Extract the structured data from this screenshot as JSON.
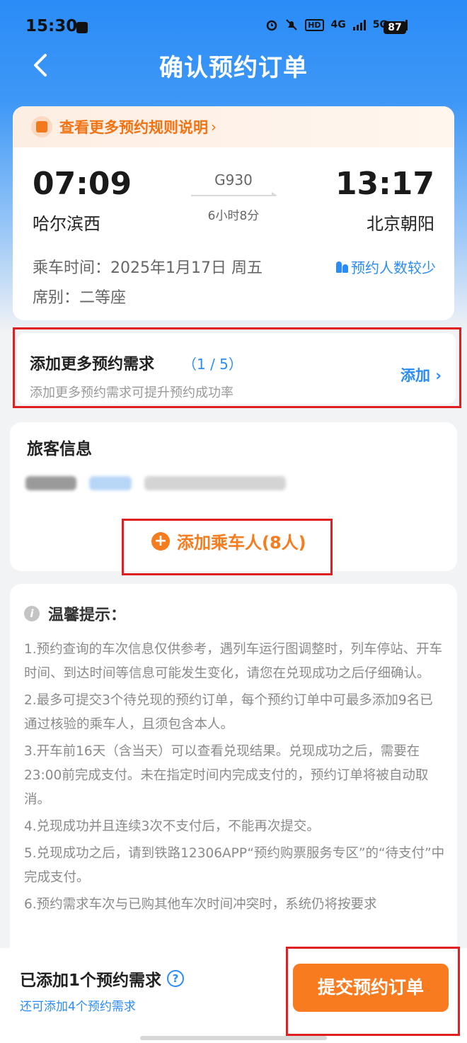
{
  "status": {
    "time": "15:30",
    "battery": "87",
    "net1": "4G",
    "net2": "5G"
  },
  "nav": {
    "title": "确认预约订单"
  },
  "rules": {
    "text": "查看更多预约规则说明",
    "chev": "›"
  },
  "trip": {
    "dep_time": "07:09",
    "arr_time": "13:17",
    "dep_station": "哈尔滨西",
    "arr_station": "北京朝阳",
    "train_no": "G930",
    "duration": "6小时8分",
    "ride_date": "乘车时间：2025年1月17日 周五",
    "seat": "席别：二等座",
    "few_people": "预约人数较少"
  },
  "requirement": {
    "title": "添加更多预约需求",
    "count": "（1 / 5）",
    "sub": "添加更多预约需求可提升预约成功率",
    "add": "添加 ›"
  },
  "passenger": {
    "title": "旅客信息",
    "add_label": "添加乘车人(8人)"
  },
  "tips": {
    "title": "温馨提示：",
    "items": [
      "1.预约查询的车次信息仅供参考，遇列车运行图调整时，列车停站、开车时间、到达时间等信息可能发生变化，请您在兑现成功之后仔细确认。",
      "2.最多可提交3个待兑现的预约订单，每个预约订单中可最多添加9名已通过核验的乘车人，且须包含本人。",
      "3.开车前16天（含当天）可以查看兑现结果。兑现成功之后，需要在23:00前完成支付。未在指定时间内完成支付的，预约订单将被自动取消。",
      "4.兑现成功并且连续3次不支付后，不能再次提交。",
      "5.兑现成功之后，请到铁路12306APP“预约购票服务专区”的“待支付”中完成支付。",
      "6.预约需求车次与已购其他车次时间冲突时，系统仍将按要求"
    ]
  },
  "bottom": {
    "added": "已添加1个预约需求",
    "remain": "还可添加4个预约需求",
    "submit": "提交预约订单"
  },
  "colors": {
    "primary": "#2b8cf7",
    "accent": "#f97b1f",
    "highlight": "#e02020"
  }
}
